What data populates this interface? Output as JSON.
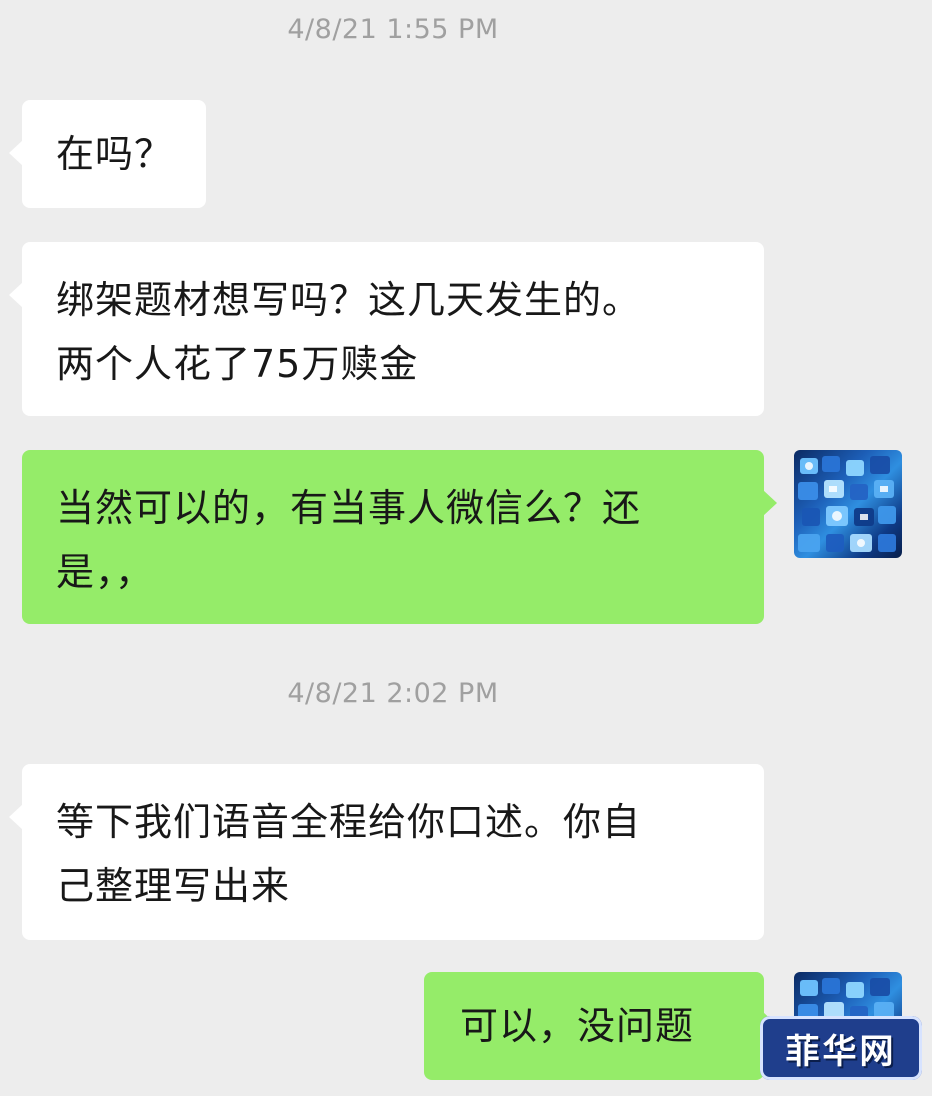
{
  "chat": {
    "timestamp_1": "4/8/21 1:55 PM",
    "timestamp_2": "4/8/21 2:02 PM",
    "messages": [
      {
        "sender": "other",
        "lines": [
          "在吗？"
        ]
      },
      {
        "sender": "other",
        "lines": [
          "绑架题材想写吗？这几天发生的。",
          "两个人花了75万赎金"
        ]
      },
      {
        "sender": "me",
        "lines": [
          "当然可以的，有当事人微信么？还",
          "是，，"
        ]
      },
      {
        "sender": "other",
        "lines": [
          "等下我们语音全程给你口述。你自",
          "己整理写出来"
        ]
      },
      {
        "sender": "me",
        "lines": [
          "可以，没问题"
        ]
      }
    ]
  },
  "watermark": {
    "text": "菲华网"
  },
  "colors": {
    "background": "#ededed",
    "incoming_bubble": "#ffffff",
    "outgoing_bubble": "#95ec69",
    "timestamp": "#a0a0a0"
  },
  "icons": {
    "avatar": "apps-grid-avatar-icon"
  }
}
